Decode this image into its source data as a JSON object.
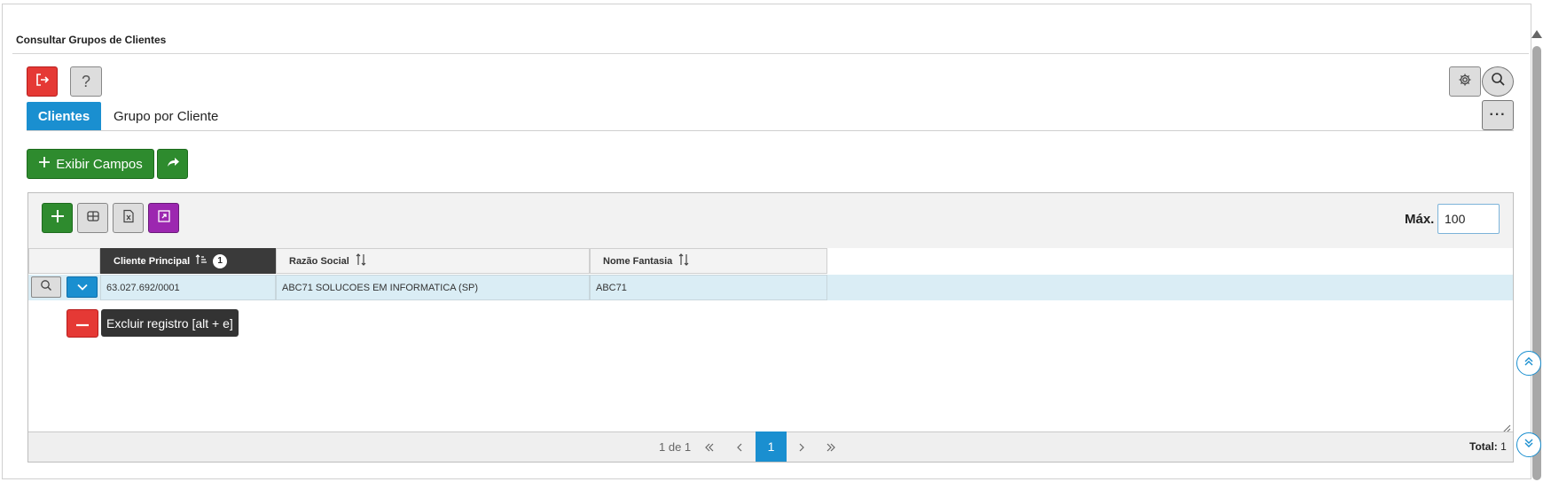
{
  "page": {
    "title": "Consultar Grupos de Clientes"
  },
  "toolbar": {
    "exit_icon": "exit-icon",
    "help_label": "?",
    "settings_icon": "gear-icon",
    "search_icon": "search-icon",
    "more_label": "···"
  },
  "tabs": [
    {
      "label": "Clientes",
      "active": true
    },
    {
      "label": "Grupo por Cliente",
      "active": false
    }
  ],
  "actions": {
    "exibir_campos_label": "Exibir Campos",
    "share_icon": "share-icon"
  },
  "grid": {
    "max_label": "Máx.",
    "max_value": "100",
    "columns": [
      {
        "label": "Cliente Principal",
        "sorted": true,
        "sort_order": "1"
      },
      {
        "label": "Razão Social",
        "sorted": false
      },
      {
        "label": "Nome Fantasia",
        "sorted": false
      }
    ],
    "rows": [
      {
        "cliente_principal": "63.027.692/0001",
        "razao_social": "ABC71 SOLUCOES EM INFORMATICA (SP)",
        "nome_fantasia": "ABC71"
      }
    ],
    "delete_tooltip": "Excluir registro [alt + e]"
  },
  "pagination": {
    "page_info": "1 de 1",
    "current_page": "1",
    "total_label": "Total:",
    "total_value": "1"
  },
  "colors": {
    "primary": "#1a8fd0",
    "success": "#2e8b2e",
    "danger": "#e53935",
    "purple": "#9c27b0"
  }
}
